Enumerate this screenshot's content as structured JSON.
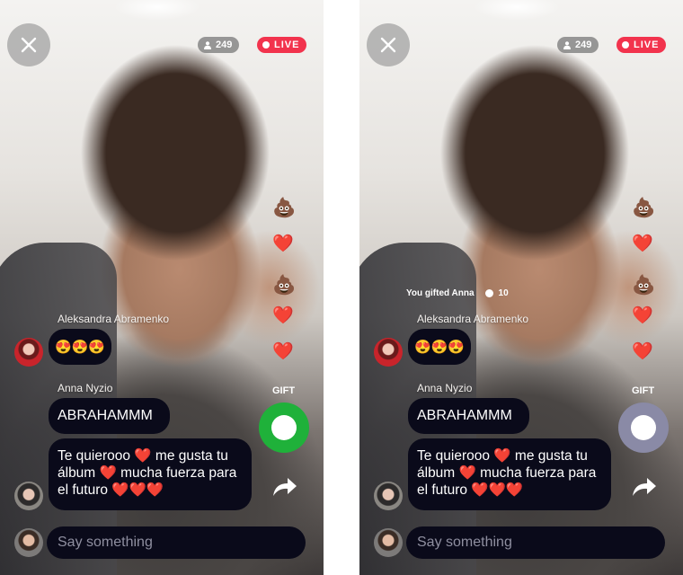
{
  "screens": [
    {
      "viewer_count": "249",
      "live_label": "LIVE",
      "reactions": [
        "💩",
        "❤️",
        "💩",
        "❤️",
        "❤️"
      ],
      "gifted_notice": null,
      "messages": [
        {
          "author": "Aleksandra Abramenko",
          "text": "😍😍😍"
        },
        {
          "author": "Anna Nyzio",
          "text": "ABRAHAMMM"
        },
        {
          "author": "",
          "text": "Te quierooo ❤️ me gusta tu álbum ❤️ mucha fuerza para el futuro ❤️❤️❤️"
        }
      ],
      "gift_label": "GIFT",
      "gift_button_color": "#1fb13a",
      "composer_placeholder": "Say something"
    },
    {
      "viewer_count": "249",
      "live_label": "LIVE",
      "reactions": [
        "💩",
        "❤️",
        "💩",
        "❤️",
        "❤️"
      ],
      "gifted_notice": {
        "text": "You gifted Anna",
        "amount": "10"
      },
      "messages": [
        {
          "author": "Aleksandra Abramenko",
          "text": "😍😍😍"
        },
        {
          "author": "Anna Nyzio",
          "text": "ABRAHAMMM"
        },
        {
          "author": "",
          "text": "Te quierooo ❤️ me gusta tu álbum ❤️ mucha fuerza para el futuro ❤️❤️❤️"
        }
      ],
      "gift_label": "GIFT",
      "gift_button_color": "#8a8aa6",
      "composer_placeholder": "Say something"
    }
  ]
}
